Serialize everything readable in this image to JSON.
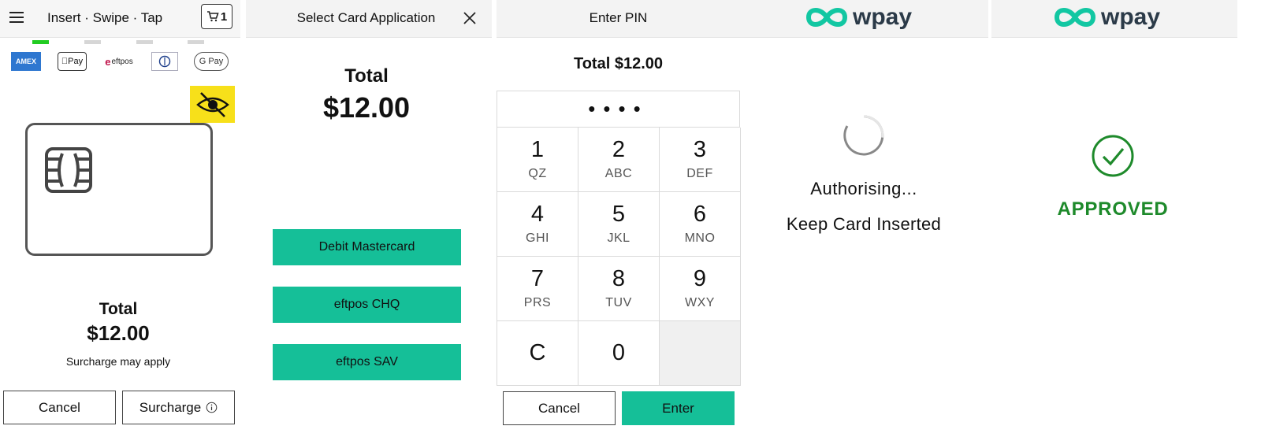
{
  "screen1": {
    "title": "Insert · Swipe · Tap",
    "cart_count": "1",
    "total_label": "Total",
    "total_value": "$12.00",
    "surcharge_note": "Surcharge may apply",
    "cancel_label": "Cancel",
    "surcharge_label": "Surcharge",
    "card_logos": [
      "amex-logo",
      "apple-pay-logo",
      "eftpos-logo",
      "diners-club-logo",
      "google-pay-logo"
    ],
    "apple_pay_text": "Pay",
    "eftpos_text": "eftpos",
    "google_pay_text": "G Pay",
    "amex_text": "AMEX",
    "accessibility_color": "#f7e01a",
    "progress_active_color": "#22cc22"
  },
  "screen2": {
    "title": "Select Card Application",
    "total_label": "Total",
    "total_value": "$12.00",
    "options": [
      "Debit Mastercard",
      "eftpos CHQ",
      "eftpos SAV"
    ],
    "option_color": "#15bf98"
  },
  "screen3": {
    "title": "Enter PIN",
    "total_text": "Total $12.00",
    "pin_mask": "••••",
    "keys": [
      {
        "digit": "1",
        "letters": "QZ"
      },
      {
        "digit": "2",
        "letters": "ABC"
      },
      {
        "digit": "3",
        "letters": "DEF"
      },
      {
        "digit": "4",
        "letters": "GHI"
      },
      {
        "digit": "5",
        "letters": "JKL"
      },
      {
        "digit": "6",
        "letters": "MNO"
      },
      {
        "digit": "7",
        "letters": "PRS"
      },
      {
        "digit": "8",
        "letters": "TUV"
      },
      {
        "digit": "9",
        "letters": "WXY"
      },
      {
        "digit": "C",
        "letters": ""
      },
      {
        "digit": "0",
        "letters": ""
      }
    ],
    "cancel_label": "Cancel",
    "enter_label": "Enter"
  },
  "screen4": {
    "brand": "wpay",
    "status": "Authorising...",
    "instruction": "Keep Card Inserted"
  },
  "screen5": {
    "brand": "wpay",
    "status": "APPROVED",
    "status_color": "#1e8a2b"
  },
  "brand_colors": {
    "wpay_teal": "#12c7a2",
    "wpay_text": "#2b3a48"
  }
}
